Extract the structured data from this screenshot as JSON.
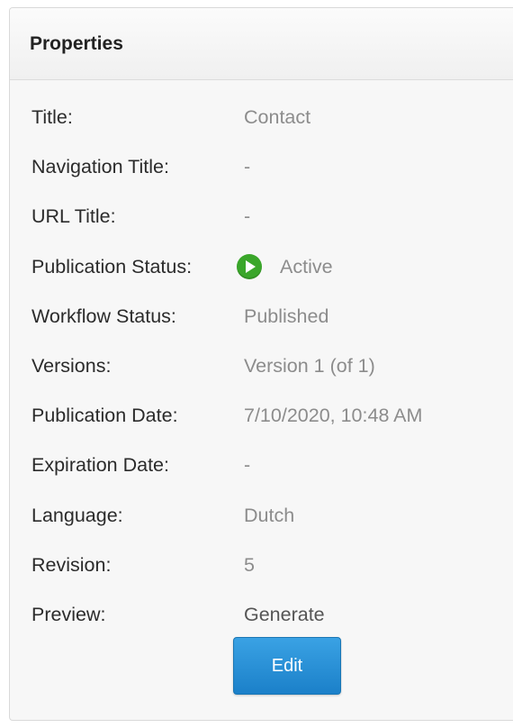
{
  "panel": {
    "title": "Properties"
  },
  "properties": [
    {
      "label": "Title:",
      "value": "Contact"
    },
    {
      "label": "Navigation Title:",
      "value": "-"
    },
    {
      "label": "URL Title:",
      "value": "-"
    },
    {
      "label": "Publication Status:",
      "value": "Active",
      "icon": "play-icon",
      "icon_color": "#3aa62a"
    },
    {
      "label": "Workflow Status:",
      "value": "Published"
    },
    {
      "label": "Versions:",
      "value": "Version 1 (of 1)"
    },
    {
      "label": "Publication Date:",
      "value": "7/10/2020, 10:48 AM"
    },
    {
      "label": "Expiration Date:",
      "value": "-"
    },
    {
      "label": "Language:",
      "value": "Dutch"
    },
    {
      "label": "Revision:",
      "value": "5"
    },
    {
      "label": "Preview:",
      "value": "Generate"
    }
  ],
  "actions": {
    "edit_label": "Edit",
    "edit_color": "#1b80c9"
  }
}
